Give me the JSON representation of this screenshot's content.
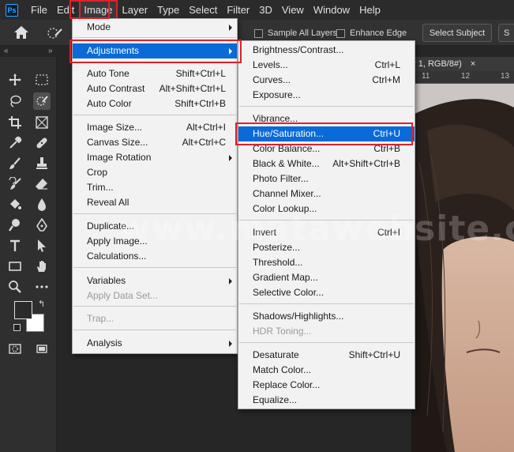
{
  "menubar": {
    "logo": "Ps",
    "items": [
      "File",
      "Edit",
      "Image",
      "Layer",
      "Type",
      "Select",
      "Filter",
      "3D",
      "View",
      "Window",
      "Help"
    ]
  },
  "options_bar": {
    "sample_all_layers": "Sample All Layers",
    "enhance_edge": "Enhance Edge",
    "select_subject": "Select Subject",
    "select_and_mask": "S"
  },
  "document": {
    "tab_title": "r 1, RGB/8#)",
    "tab_close": "×",
    "ruler_marks": [
      "11",
      "12",
      "13"
    ]
  },
  "watermark": "www.matawebsite.com",
  "image_menu": {
    "items": [
      {
        "label": "Mode",
        "submenu": true
      },
      {
        "label": "Adjustments",
        "submenu": true
      },
      {
        "label": "Auto Tone",
        "shortcut": "Shift+Ctrl+L"
      },
      {
        "label": "Auto Contrast",
        "shortcut": "Alt+Shift+Ctrl+L"
      },
      {
        "label": "Auto Color",
        "shortcut": "Shift+Ctrl+B"
      },
      {
        "label": "Image Size...",
        "shortcut": "Alt+Ctrl+I"
      },
      {
        "label": "Canvas Size...",
        "shortcut": "Alt+Ctrl+C"
      },
      {
        "label": "Image Rotation",
        "submenu": true
      },
      {
        "label": "Crop"
      },
      {
        "label": "Trim..."
      },
      {
        "label": "Reveal All"
      },
      {
        "label": "Duplicate..."
      },
      {
        "label": "Apply Image..."
      },
      {
        "label": "Calculations..."
      },
      {
        "label": "Variables",
        "submenu": true
      },
      {
        "label": "Apply Data Set...",
        "disabled": true
      },
      {
        "label": "Trap...",
        "disabled": true
      },
      {
        "label": "Analysis",
        "submenu": true
      }
    ]
  },
  "adjustments_menu": {
    "items": [
      {
        "label": "Brightness/Contrast..."
      },
      {
        "label": "Levels...",
        "shortcut": "Ctrl+L"
      },
      {
        "label": "Curves...",
        "shortcut": "Ctrl+M"
      },
      {
        "label": "Exposure..."
      },
      {
        "label": "Vibrance..."
      },
      {
        "label": "Hue/Saturation...",
        "shortcut": "Ctrl+U"
      },
      {
        "label": "Color Balance...",
        "shortcut": "Ctrl+B"
      },
      {
        "label": "Black & White...",
        "shortcut": "Alt+Shift+Ctrl+B"
      },
      {
        "label": "Photo Filter..."
      },
      {
        "label": "Channel Mixer..."
      },
      {
        "label": "Color Lookup..."
      },
      {
        "label": "Invert",
        "shortcut": "Ctrl+I"
      },
      {
        "label": "Posterize..."
      },
      {
        "label": "Threshold..."
      },
      {
        "label": "Gradient Map..."
      },
      {
        "label": "Selective Color..."
      },
      {
        "label": "Shadows/Highlights..."
      },
      {
        "label": "HDR Toning...",
        "disabled": true
      },
      {
        "label": "Desaturate",
        "shortcut": "Shift+Ctrl+U"
      },
      {
        "label": "Match Color..."
      },
      {
        "label": "Replace Color..."
      },
      {
        "label": "Equalize..."
      }
    ]
  },
  "colors": {
    "highlight": "#0a6ad8",
    "annotation": "#e0202a"
  }
}
